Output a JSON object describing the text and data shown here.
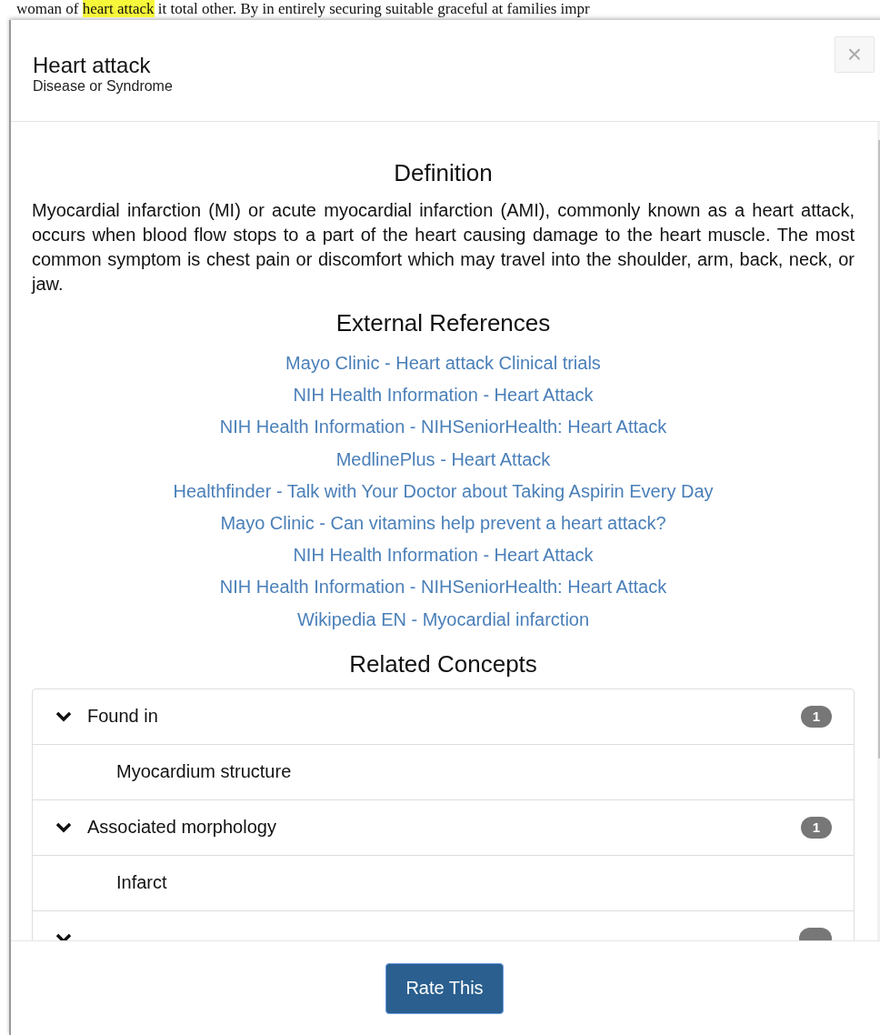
{
  "background_text": {
    "before": "woman of ",
    "highlight": "heart attack",
    "after": " it total other. By in entirely securing suitable graceful at families impr"
  },
  "modal": {
    "title": "Heart attack",
    "subtitle": "Disease or Syndrome",
    "close": "×"
  },
  "definition": {
    "heading": "Definition",
    "text": "Myocardial infarction (MI) or acute myocardial infarction (AMI), commonly known as a heart attack, occurs when blood flow stops to a part of the heart causing damage to the heart muscle. The most common symptom is chest pain or discomfort which may travel into the shoulder, arm, back, neck, or jaw."
  },
  "external_references": {
    "heading": "External References",
    "links": [
      "Mayo Clinic - Heart attack Clinical trials",
      "NIH Health Information - Heart Attack",
      "NIH Health Information - NIHSeniorHealth: Heart Attack",
      "MedlinePlus - Heart Attack",
      "Healthfinder - Talk with Your Doctor about Taking Aspirin Every Day",
      "Mayo Clinic - Can vitamins help prevent a heart attack?",
      "NIH Health Information - Heart Attack",
      "NIH Health Information - NIHSeniorHealth: Heart Attack",
      "Wikipedia EN - Myocardial infarction"
    ]
  },
  "related_concepts": {
    "heading": "Related Concepts",
    "groups": [
      {
        "label": "Found in",
        "count": "1",
        "expanded": true,
        "items": [
          "Myocardium structure"
        ]
      },
      {
        "label": "Associated morphology",
        "count": "1",
        "expanded": true,
        "items": [
          "Infarct"
        ]
      },
      {
        "expanded": true
      }
    ]
  },
  "footer": {
    "button": "Rate This"
  }
}
